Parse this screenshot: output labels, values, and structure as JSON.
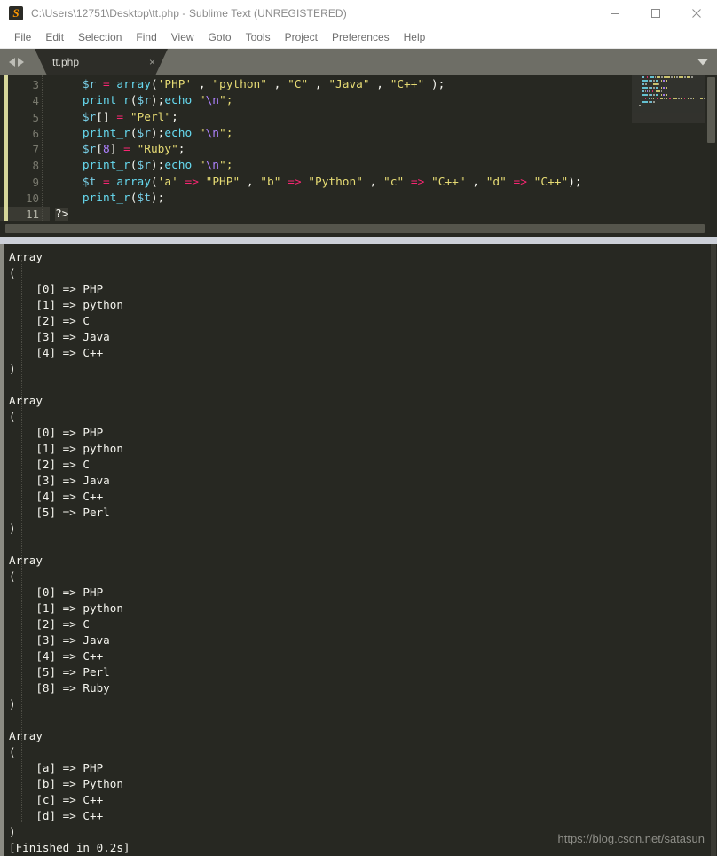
{
  "window": {
    "title": "C:\\Users\\12751\\Desktop\\tt.php - Sublime Text (UNREGISTERED)",
    "app_icon": "sublime-text-icon",
    "minimize_label": "Minimize",
    "maximize_label": "Maximize",
    "close_label": "Close"
  },
  "menubar": {
    "items": [
      {
        "label": "File"
      },
      {
        "label": "Edit"
      },
      {
        "label": "Selection"
      },
      {
        "label": "Find"
      },
      {
        "label": "View"
      },
      {
        "label": "Goto"
      },
      {
        "label": "Tools"
      },
      {
        "label": "Project"
      },
      {
        "label": "Preferences"
      },
      {
        "label": "Help"
      }
    ]
  },
  "tabbar": {
    "prev_icon": "chevron-left-icon",
    "next_icon": "chevron-right-icon",
    "dropdown_icon": "chevron-down-icon",
    "tabs": [
      {
        "label": "tt.php",
        "close_glyph": "×",
        "active": true
      }
    ]
  },
  "editor": {
    "language": "PHP",
    "first_visible_line": 3,
    "active_line": 11,
    "line_numbers": [
      "3",
      "4",
      "5",
      "6",
      "7",
      "8",
      "9",
      "10",
      "11"
    ],
    "lines": [
      {
        "number": "3",
        "tokens": [
          {
            "t": "    ",
            "c": "plain"
          },
          {
            "t": "$r",
            "c": "var"
          },
          {
            "t": " ",
            "c": "plain"
          },
          {
            "t": "=",
            "c": "op"
          },
          {
            "t": " ",
            "c": "plain"
          },
          {
            "t": "array",
            "c": "fn"
          },
          {
            "t": "(",
            "c": "punct"
          },
          {
            "t": "'PHP'",
            "c": "str"
          },
          {
            "t": " , ",
            "c": "punct"
          },
          {
            "t": "\"python\"",
            "c": "str"
          },
          {
            "t": " , ",
            "c": "punct"
          },
          {
            "t": "\"C\"",
            "c": "str"
          },
          {
            "t": " , ",
            "c": "punct"
          },
          {
            "t": "\"Java\"",
            "c": "str"
          },
          {
            "t": " , ",
            "c": "punct"
          },
          {
            "t": "\"C++\"",
            "c": "str"
          },
          {
            "t": " );",
            "c": "punct"
          }
        ]
      },
      {
        "number": "4",
        "tokens": [
          {
            "t": "    ",
            "c": "plain"
          },
          {
            "t": "print_r",
            "c": "fn"
          },
          {
            "t": "(",
            "c": "punct"
          },
          {
            "t": "$r",
            "c": "var"
          },
          {
            "t": ");",
            "c": "punct"
          },
          {
            "t": "echo",
            "c": "fn"
          },
          {
            "t": " ",
            "c": "plain"
          },
          {
            "t": "\"",
            "c": "str"
          },
          {
            "t": "\\n",
            "c": "esc"
          },
          {
            "t": "\";",
            "c": "str"
          }
        ]
      },
      {
        "number": "5",
        "tokens": [
          {
            "t": "    ",
            "c": "plain"
          },
          {
            "t": "$r",
            "c": "var"
          },
          {
            "t": "[]",
            "c": "punct"
          },
          {
            "t": " ",
            "c": "plain"
          },
          {
            "t": "=",
            "c": "op"
          },
          {
            "t": " ",
            "c": "plain"
          },
          {
            "t": "\"Perl\"",
            "c": "str"
          },
          {
            "t": ";",
            "c": "punct"
          }
        ]
      },
      {
        "number": "6",
        "tokens": [
          {
            "t": "    ",
            "c": "plain"
          },
          {
            "t": "print_r",
            "c": "fn"
          },
          {
            "t": "(",
            "c": "punct"
          },
          {
            "t": "$r",
            "c": "var"
          },
          {
            "t": ");",
            "c": "punct"
          },
          {
            "t": "echo",
            "c": "fn"
          },
          {
            "t": " ",
            "c": "plain"
          },
          {
            "t": "\"",
            "c": "str"
          },
          {
            "t": "\\n",
            "c": "esc"
          },
          {
            "t": "\";",
            "c": "str"
          }
        ]
      },
      {
        "number": "7",
        "tokens": [
          {
            "t": "    ",
            "c": "plain"
          },
          {
            "t": "$r",
            "c": "var"
          },
          {
            "t": "[",
            "c": "punct"
          },
          {
            "t": "8",
            "c": "num"
          },
          {
            "t": "]",
            "c": "punct"
          },
          {
            "t": " ",
            "c": "plain"
          },
          {
            "t": "=",
            "c": "op"
          },
          {
            "t": " ",
            "c": "plain"
          },
          {
            "t": "\"Ruby\"",
            "c": "str"
          },
          {
            "t": ";",
            "c": "punct"
          }
        ]
      },
      {
        "number": "8",
        "tokens": [
          {
            "t": "    ",
            "c": "plain"
          },
          {
            "t": "print_r",
            "c": "fn"
          },
          {
            "t": "(",
            "c": "punct"
          },
          {
            "t": "$r",
            "c": "var"
          },
          {
            "t": ");",
            "c": "punct"
          },
          {
            "t": "echo",
            "c": "fn"
          },
          {
            "t": " ",
            "c": "plain"
          },
          {
            "t": "\"",
            "c": "str"
          },
          {
            "t": "\\n",
            "c": "esc"
          },
          {
            "t": "\";",
            "c": "str"
          }
        ]
      },
      {
        "number": "9",
        "tokens": [
          {
            "t": "    ",
            "c": "plain"
          },
          {
            "t": "$t",
            "c": "var"
          },
          {
            "t": " ",
            "c": "plain"
          },
          {
            "t": "=",
            "c": "op"
          },
          {
            "t": " ",
            "c": "plain"
          },
          {
            "t": "array",
            "c": "fn"
          },
          {
            "t": "(",
            "c": "punct"
          },
          {
            "t": "'a'",
            "c": "str"
          },
          {
            "t": " ",
            "c": "plain"
          },
          {
            "t": "=>",
            "c": "op"
          },
          {
            "t": " ",
            "c": "plain"
          },
          {
            "t": "\"PHP\"",
            "c": "str"
          },
          {
            "t": " , ",
            "c": "punct"
          },
          {
            "t": "\"b\"",
            "c": "str"
          },
          {
            "t": " ",
            "c": "plain"
          },
          {
            "t": "=>",
            "c": "op"
          },
          {
            "t": " ",
            "c": "plain"
          },
          {
            "t": "\"Python\"",
            "c": "str"
          },
          {
            "t": " , ",
            "c": "punct"
          },
          {
            "t": "\"c\"",
            "c": "str"
          },
          {
            "t": " ",
            "c": "plain"
          },
          {
            "t": "=>",
            "c": "op"
          },
          {
            "t": " ",
            "c": "plain"
          },
          {
            "t": "\"C++\"",
            "c": "str"
          },
          {
            "t": " , ",
            "c": "punct"
          },
          {
            "t": "\"d\"",
            "c": "str"
          },
          {
            "t": " ",
            "c": "plain"
          },
          {
            "t": "=>",
            "c": "op"
          },
          {
            "t": " ",
            "c": "plain"
          },
          {
            "t": "\"C++\"",
            "c": "str"
          },
          {
            "t": ");",
            "c": "punct"
          }
        ]
      },
      {
        "number": "10",
        "tokens": [
          {
            "t": "    ",
            "c": "plain"
          },
          {
            "t": "print_r",
            "c": "fn"
          },
          {
            "t": "(",
            "c": "punct"
          },
          {
            "t": "$t",
            "c": "var"
          },
          {
            "t": ");",
            "c": "punct"
          }
        ]
      },
      {
        "number": "11",
        "active": true,
        "tokens": [
          {
            "t": "?>",
            "c": "tag"
          }
        ]
      }
    ]
  },
  "output": {
    "text": "Array\n(\n    [0] => PHP\n    [1] => python\n    [2] => C\n    [3] => Java\n    [4] => C++\n)\n\nArray\n(\n    [0] => PHP\n    [1] => python\n    [2] => C\n    [3] => Java\n    [4] => C++\n    [5] => Perl\n)\n\nArray\n(\n    [0] => PHP\n    [1] => python\n    [2] => C\n    [3] => Java\n    [4] => C++\n    [5] => Perl\n    [8] => Ruby\n)\n\nArray\n(\n    [a] => PHP\n    [b] => Python\n    [c] => C++\n    [d] => C++\n)\n[Finished in 0.2s]",
    "status": "[Finished in 0.2s]",
    "watermark": "https://blog.csdn.net/satasun"
  },
  "colors": {
    "editor_bg": "#272822",
    "output_bg": "#272822",
    "tabbar_bg": "#6e6e66",
    "active_tab_bg": "#2d2d28",
    "titlebar_bg": "#ffffff",
    "accent_stripe": "#d6d69a",
    "string": "#e6db74",
    "variable": "#79d0e8",
    "operator": "#f92672",
    "function": "#66d9ef",
    "number": "#ae81ff",
    "text": "#f8f8f2",
    "line_number": "#79796e",
    "panel_divider": "#ccd0d8"
  }
}
